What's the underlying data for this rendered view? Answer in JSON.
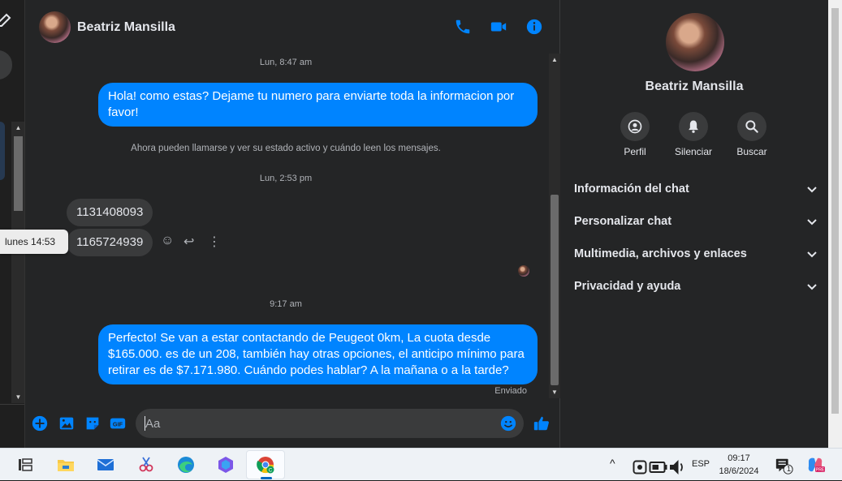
{
  "contact": {
    "name": "Beatriz Mansilla"
  },
  "colors": {
    "accent": "#0084ff",
    "background": "#242526",
    "bubble_in": "#3a3b3c"
  },
  "header_icons": [
    "phone-icon",
    "video-camera-icon",
    "info-icon"
  ],
  "messages": {
    "ts1": "Lun, 8:47 am",
    "out1": "Hola! como estas? Dejame tu numero para enviarte toda la informacion por favor!",
    "system": "Ahora pueden llamarse y ver su estado activo y cuándo leen los mensajes.",
    "ts2": "Lun, 2:53 pm",
    "in1": "1131408093",
    "in2": "1165724939",
    "tooltip": "lunes 14:53",
    "ts3": "9:17 am",
    "out2": "Perfecto!  Se van a estar contactando de Peugeot 0km, La cuota desde $165.000. es de un 208, también hay otras opciones, el anticipo mínimo para retirar es de $7.171.980. Cuándo podes hablar? A la mañana o a la tarde?",
    "status": "Enviado"
  },
  "composer": {
    "placeholder": "Aa"
  },
  "panel": {
    "actions": [
      {
        "label": "Perfil",
        "icon": "profile-icon"
      },
      {
        "label": "Silenciar",
        "icon": "bell-icon"
      },
      {
        "label": "Buscar",
        "icon": "search-icon"
      }
    ],
    "sections": [
      "Información del chat",
      "Personalizar chat",
      "Multimedia, archivos y enlaces",
      "Privacidad y ayuda"
    ]
  },
  "taskbar": {
    "language": "ESP",
    "time": "09:17",
    "date": "18/6/2024",
    "notifications": "1"
  }
}
